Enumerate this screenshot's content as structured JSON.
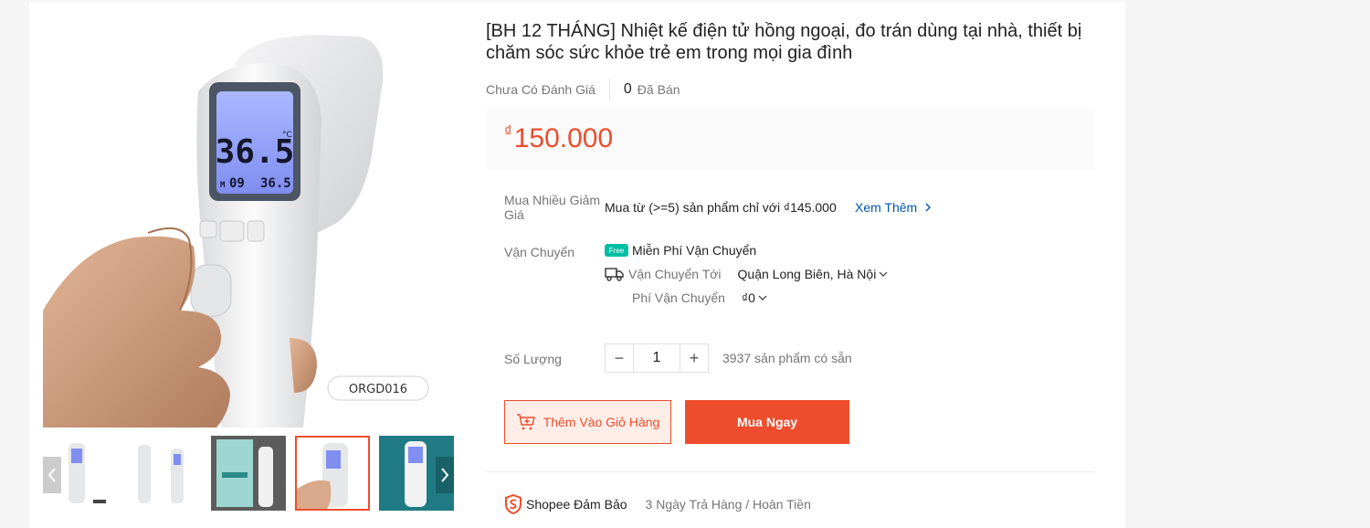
{
  "product": {
    "title": "[BH 12 THÁNG] Nhiệt kế điện tử hồng ngoại, đo trán dùng tại nhà, thiết bị chăm sóc sức khỏe trẻ em trong mọi gia đình",
    "rating_text": "Chưa Có Đánh Giá",
    "sold_count": "0",
    "sold_label": "Đã Bán",
    "price_currency": "₫",
    "price": "150.000",
    "device_display": {
      "main_temp": "36.5",
      "unit": "°C",
      "mem": "M",
      "mem_num": "09",
      "last_temp": "36.5"
    },
    "model_label": "ORGD016"
  },
  "bulk": {
    "label": "Mua Nhiều Giảm Giá",
    "text": "Mua từ (>=5) sản phẩm chỉ với ₫145.000",
    "see_more": "Xem Thêm"
  },
  "shipping": {
    "label": "Vận Chuyển",
    "free_badge": "Free",
    "free_text": "Miễn Phí Vận Chuyển",
    "to_label": "Vận Chuyển Tới",
    "to_value": "Quận Long Biên, Hà Nội",
    "fee_label": "Phí Vận Chuyển",
    "fee_value": "₫0"
  },
  "quantity": {
    "label": "Số Lượng",
    "minus": "−",
    "value": "1",
    "plus": "+",
    "stock": "3937 sản phẩm có sẵn"
  },
  "actions": {
    "add_to_cart": "Thêm Vào Giỏ Hàng",
    "buy_now": "Mua Ngay"
  },
  "guarantee": {
    "brand": "Shopee Đảm Bảo",
    "policy": "3 Ngày Trả Hàng / Hoàn Tiền"
  },
  "colors": {
    "accent": "#ee4d2d",
    "link": "#0055aa",
    "free_ship": "#00bfa5"
  }
}
